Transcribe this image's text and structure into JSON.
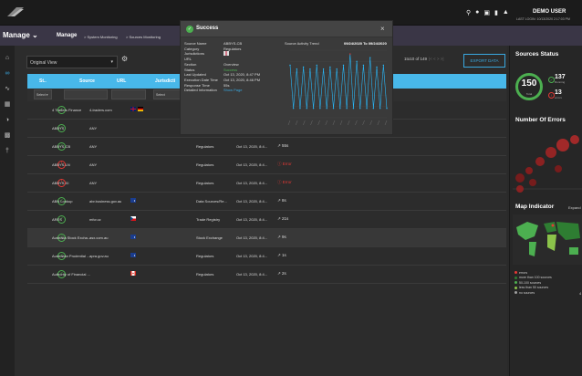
{
  "header": {
    "user": "DEMO USER",
    "last_login": "LAST LOGIN: 10/13/2020 2:17:03 PM"
  },
  "breadcrumb": {
    "manage_dropdown": "Manage ⌄",
    "manage": "Manage",
    "crumb1": "System Monitoring",
    "crumb2": "Sources Monitoring"
  },
  "toolbar": {
    "view": "Original View",
    "pagination": "1to10 of 149",
    "export_label": "EXPORT DATA"
  },
  "table": {
    "headers": [
      "St..",
      "Source",
      "URL",
      "Jurisdicti",
      "Category",
      "Last Updated",
      "Response Time"
    ],
    "filter_select": "Select",
    "filter_select2": "Select",
    "rows": [
      {
        "status": "ok",
        "source": "4 Traders Finance",
        "url": "4-traders.com",
        "flag": "uk-de",
        "category": "",
        "updated": "",
        "trend": ""
      },
      {
        "status": "ok",
        "source": "ABBYS",
        "url": "ANY",
        "flag": "",
        "category": "",
        "updated": "",
        "trend": ""
      },
      {
        "status": "ok",
        "source": "ABBYS-CB",
        "url": "ANY",
        "flag": "",
        "category": "Regulators",
        "updated": "Oct 13, 2020, 8:4...",
        "trend": "55s"
      },
      {
        "status": "err",
        "source": "ABBYS-LN",
        "url": "ANY",
        "flag": "",
        "category": "Regulators",
        "updated": "Oct 13, 2020, 8:4...",
        "trend": "Error"
      },
      {
        "status": "err",
        "source": "ABBYS-XI",
        "url": "ANY",
        "flag": "",
        "category": "Regulators",
        "updated": "Oct 13, 2020, 8:4...",
        "trend": "Error"
      },
      {
        "status": "ok",
        "source": "ABN Lookup",
        "url": "abr.business.gov.au",
        "flag": "au",
        "category": "Data Sources/Re...",
        "updated": "Oct 13, 2020, 8:4...",
        "trend": "8s"
      },
      {
        "status": "ok",
        "source": "ARES",
        "url": "mfcr.cz",
        "flag": "cz",
        "category": "Trade Registry",
        "updated": "Oct 13, 2020, 8:4...",
        "trend": "21s"
      },
      {
        "status": "ok",
        "source": "Australia Stock Excha...",
        "url": "asx.com.au",
        "flag": "au",
        "category": "Stock Exchange",
        "updated": "Oct 13, 2020, 8:4...",
        "trend": "9s"
      },
      {
        "status": "ok",
        "source": "Australian Prudential ...",
        "url": "apra.gov.au",
        "flag": "au",
        "category": "Regulators",
        "updated": "Oct 13, 2020, 8:4...",
        "trend": "1s"
      },
      {
        "status": "ok",
        "source": "Authority of Financial ...",
        "url": "",
        "flag": "ca",
        "category": "Regulators",
        "updated": "Oct 13, 2020, 8:4...",
        "trend": "2s"
      }
    ]
  },
  "right_panel": {
    "sources_status_title": "Sources Status",
    "total": "150",
    "total_label": "Total",
    "running_count": "137",
    "running_label": "Running",
    "error_count": "13",
    "error_label": "errors",
    "errors_title": "Number Of Errors",
    "map_title": "Map Indicator",
    "expand_label": "Expand",
    "legend": [
      {
        "label": "errors",
        "color": "#e53935"
      },
      {
        "label": "more than 100 sources",
        "color": "#2e7d32"
      },
      {
        "label": "50-100 sources",
        "color": "#4caf50"
      },
      {
        "label": "less than 50 sources",
        "color": "#8bc34a"
      },
      {
        "label": "no sources",
        "color": "#9e9e9e"
      }
    ],
    "legend_extra": "4"
  },
  "modal": {
    "title": "Success",
    "fields": [
      {
        "label": "Source Name",
        "value": "ABBYS-CB"
      },
      {
        "label": "Category",
        "value": "Regulators"
      },
      {
        "label": "Jurisdictions",
        "value": ""
      },
      {
        "label": "URL",
        "value": ""
      },
      {
        "label": "Section",
        "value": "Overview"
      },
      {
        "label": "Status",
        "value": "Success"
      },
      {
        "label": "Last Updated",
        "value": "Oct 13, 2020, 8:47 PM"
      },
      {
        "label": "Execution Date Time",
        "value": "Oct 13, 2020, 8:46 PM"
      },
      {
        "label": "Response Time",
        "value": "55s"
      },
      {
        "label": "Detailed Information",
        "value": "Show Page"
      }
    ],
    "chart_title": "Source Activity Trend",
    "chart_range": "09/24/2020 To 09/24/2020",
    "chart_y_values": [
      140,
      25,
      130,
      25,
      135,
      25,
      130,
      25,
      140,
      25,
      130,
      25,
      135,
      25,
      130,
      25,
      140,
      25,
      170,
      25,
      150,
      25,
      140,
      25,
      160,
      25,
      135,
      25,
      140,
      25
    ]
  }
}
